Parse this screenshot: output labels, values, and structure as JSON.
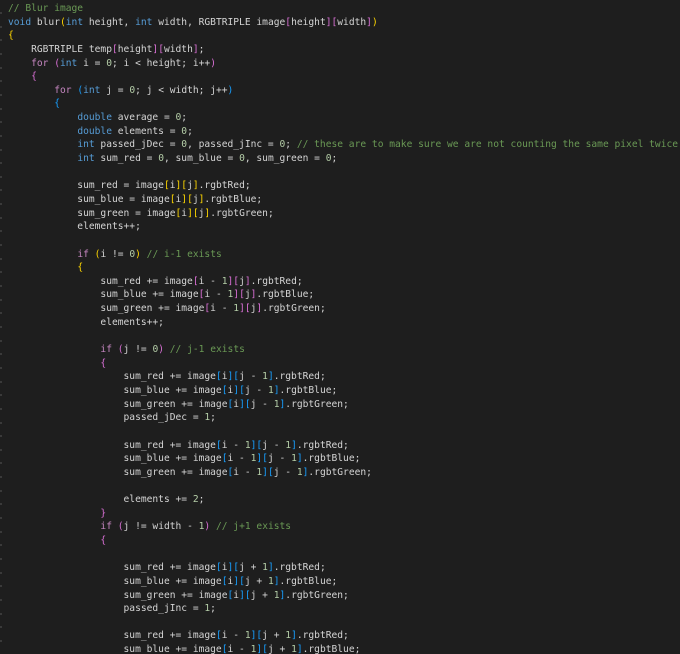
{
  "editor": {
    "colors": {
      "background": "#1e1e1e",
      "text": "#d4d4d4",
      "keyword": "#569cd6",
      "control": "#c586c0",
      "comment": "#6a9955",
      "number": "#b5cea8",
      "bracket_level_1": "#ffd700",
      "bracket_level_2": "#da70d6",
      "bracket_level_3": "#179fff"
    },
    "lines": [
      [
        {
          "t": "// Blur image",
          "c": "cm"
        }
      ],
      [
        {
          "t": "void",
          "c": "kw"
        },
        {
          "t": " blur"
        },
        {
          "t": "(",
          "c": "b1"
        },
        {
          "t": "int",
          "c": "kw"
        },
        {
          "t": " height, "
        },
        {
          "t": "int",
          "c": "kw"
        },
        {
          "t": " width, RGBTRIPLE image"
        },
        {
          "t": "[",
          "c": "b2"
        },
        {
          "t": "height"
        },
        {
          "t": "]",
          "c": "b2"
        },
        {
          "t": "[",
          "c": "b2"
        },
        {
          "t": "width"
        },
        {
          "t": "]",
          "c": "b2"
        },
        {
          "t": ")",
          "c": "b1"
        }
      ],
      [
        {
          "t": "{",
          "c": "b1"
        }
      ],
      [
        {
          "t": "    RGBTRIPLE temp"
        },
        {
          "t": "[",
          "c": "b2"
        },
        {
          "t": "height"
        },
        {
          "t": "]",
          "c": "b2"
        },
        {
          "t": "[",
          "c": "b2"
        },
        {
          "t": "width"
        },
        {
          "t": "]",
          "c": "b2"
        },
        {
          "t": ";"
        }
      ],
      [
        {
          "t": "    "
        },
        {
          "t": "for",
          "c": "ctl"
        },
        {
          "t": " "
        },
        {
          "t": "(",
          "c": "b2"
        },
        {
          "t": "int",
          "c": "kw"
        },
        {
          "t": " i = "
        },
        {
          "t": "0",
          "c": "num"
        },
        {
          "t": "; i < height; i++"
        },
        {
          "t": ")",
          "c": "b2"
        }
      ],
      [
        {
          "t": "    "
        },
        {
          "t": "{",
          "c": "b2"
        }
      ],
      [
        {
          "t": "        "
        },
        {
          "t": "for",
          "c": "ctl"
        },
        {
          "t": " "
        },
        {
          "t": "(",
          "c": "b3"
        },
        {
          "t": "int",
          "c": "kw"
        },
        {
          "t": " j = "
        },
        {
          "t": "0",
          "c": "num"
        },
        {
          "t": "; j < width; j++"
        },
        {
          "t": ")",
          "c": "b3"
        }
      ],
      [
        {
          "t": "        "
        },
        {
          "t": "{",
          "c": "b3"
        }
      ],
      [
        {
          "t": "            "
        },
        {
          "t": "double",
          "c": "kw"
        },
        {
          "t": " average = "
        },
        {
          "t": "0",
          "c": "num"
        },
        {
          "t": ";"
        }
      ],
      [
        {
          "t": "            "
        },
        {
          "t": "double",
          "c": "kw"
        },
        {
          "t": " elements = "
        },
        {
          "t": "0",
          "c": "num"
        },
        {
          "t": ";"
        }
      ],
      [
        {
          "t": "            "
        },
        {
          "t": "int",
          "c": "kw"
        },
        {
          "t": " passed_jDec = "
        },
        {
          "t": "0",
          "c": "num"
        },
        {
          "t": ", passed_jInc = "
        },
        {
          "t": "0",
          "c": "num"
        },
        {
          "t": "; "
        },
        {
          "t": "// these are to make sure we are not counting the same pixel twice",
          "c": "cm"
        }
      ],
      [
        {
          "t": "            "
        },
        {
          "t": "int",
          "c": "kw"
        },
        {
          "t": " sum_red = "
        },
        {
          "t": "0",
          "c": "num"
        },
        {
          "t": ", sum_blue = "
        },
        {
          "t": "0",
          "c": "num"
        },
        {
          "t": ", sum_green = "
        },
        {
          "t": "0",
          "c": "num"
        },
        {
          "t": ";"
        }
      ],
      [],
      [
        {
          "t": "            sum_red = image"
        },
        {
          "t": "[",
          "c": "b1"
        },
        {
          "t": "i"
        },
        {
          "t": "]",
          "c": "b1"
        },
        {
          "t": "[",
          "c": "b1"
        },
        {
          "t": "j"
        },
        {
          "t": "]",
          "c": "b1"
        },
        {
          "t": ".rgbtRed;"
        }
      ],
      [
        {
          "t": "            sum_blue = image"
        },
        {
          "t": "[",
          "c": "b1"
        },
        {
          "t": "i"
        },
        {
          "t": "]",
          "c": "b1"
        },
        {
          "t": "[",
          "c": "b1"
        },
        {
          "t": "j"
        },
        {
          "t": "]",
          "c": "b1"
        },
        {
          "t": ".rgbtBlue;"
        }
      ],
      [
        {
          "t": "            sum_green = image"
        },
        {
          "t": "[",
          "c": "b1"
        },
        {
          "t": "i"
        },
        {
          "t": "]",
          "c": "b1"
        },
        {
          "t": "[",
          "c": "b1"
        },
        {
          "t": "j"
        },
        {
          "t": "]",
          "c": "b1"
        },
        {
          "t": ".rgbtGreen;"
        }
      ],
      [
        {
          "t": "            elements++;"
        }
      ],
      [],
      [
        {
          "t": "            "
        },
        {
          "t": "if",
          "c": "ctl"
        },
        {
          "t": " "
        },
        {
          "t": "(",
          "c": "b1"
        },
        {
          "t": "i != "
        },
        {
          "t": "0",
          "c": "num"
        },
        {
          "t": ")",
          "c": "b1"
        },
        {
          "t": " "
        },
        {
          "t": "// i-1 exists",
          "c": "cm"
        }
      ],
      [
        {
          "t": "            "
        },
        {
          "t": "{",
          "c": "b1"
        }
      ],
      [
        {
          "t": "                sum_red += image"
        },
        {
          "t": "[",
          "c": "b2"
        },
        {
          "t": "i - "
        },
        {
          "t": "1",
          "c": "num"
        },
        {
          "t": "]",
          "c": "b2"
        },
        {
          "t": "[",
          "c": "b2"
        },
        {
          "t": "j"
        },
        {
          "t": "]",
          "c": "b2"
        },
        {
          "t": ".rgbtRed;"
        }
      ],
      [
        {
          "t": "                sum_blue += image"
        },
        {
          "t": "[",
          "c": "b2"
        },
        {
          "t": "i - "
        },
        {
          "t": "1",
          "c": "num"
        },
        {
          "t": "]",
          "c": "b2"
        },
        {
          "t": "[",
          "c": "b2"
        },
        {
          "t": "j"
        },
        {
          "t": "]",
          "c": "b2"
        },
        {
          "t": ".rgbtBlue;"
        }
      ],
      [
        {
          "t": "                sum_green += image"
        },
        {
          "t": "[",
          "c": "b2"
        },
        {
          "t": "i - "
        },
        {
          "t": "1",
          "c": "num"
        },
        {
          "t": "]",
          "c": "b2"
        },
        {
          "t": "[",
          "c": "b2"
        },
        {
          "t": "j"
        },
        {
          "t": "]",
          "c": "b2"
        },
        {
          "t": ".rgbtGreen;"
        }
      ],
      [
        {
          "t": "                elements++;"
        }
      ],
      [],
      [
        {
          "t": "                "
        },
        {
          "t": "if",
          "c": "ctl"
        },
        {
          "t": " "
        },
        {
          "t": "(",
          "c": "b2"
        },
        {
          "t": "j != "
        },
        {
          "t": "0",
          "c": "num"
        },
        {
          "t": ")",
          "c": "b2"
        },
        {
          "t": " "
        },
        {
          "t": "// j-1 exists",
          "c": "cm"
        }
      ],
      [
        {
          "t": "                "
        },
        {
          "t": "{",
          "c": "b2"
        }
      ],
      [
        {
          "t": "                    sum_red += image"
        },
        {
          "t": "[",
          "c": "b3"
        },
        {
          "t": "i"
        },
        {
          "t": "]",
          "c": "b3"
        },
        {
          "t": "[",
          "c": "b3"
        },
        {
          "t": "j - "
        },
        {
          "t": "1",
          "c": "num"
        },
        {
          "t": "]",
          "c": "b3"
        },
        {
          "t": ".rgbtRed;"
        }
      ],
      [
        {
          "t": "                    sum_blue += image"
        },
        {
          "t": "[",
          "c": "b3"
        },
        {
          "t": "i"
        },
        {
          "t": "]",
          "c": "b3"
        },
        {
          "t": "[",
          "c": "b3"
        },
        {
          "t": "j - "
        },
        {
          "t": "1",
          "c": "num"
        },
        {
          "t": "]",
          "c": "b3"
        },
        {
          "t": ".rgbtBlue;"
        }
      ],
      [
        {
          "t": "                    sum_green += image"
        },
        {
          "t": "[",
          "c": "b3"
        },
        {
          "t": "i"
        },
        {
          "t": "]",
          "c": "b3"
        },
        {
          "t": "[",
          "c": "b3"
        },
        {
          "t": "j - "
        },
        {
          "t": "1",
          "c": "num"
        },
        {
          "t": "]",
          "c": "b3"
        },
        {
          "t": ".rgbtGreen;"
        }
      ],
      [
        {
          "t": "                    passed_jDec = "
        },
        {
          "t": "1",
          "c": "num"
        },
        {
          "t": ";"
        }
      ],
      [],
      [
        {
          "t": "                    sum_red += image"
        },
        {
          "t": "[",
          "c": "b3"
        },
        {
          "t": "i - "
        },
        {
          "t": "1",
          "c": "num"
        },
        {
          "t": "]",
          "c": "b3"
        },
        {
          "t": "[",
          "c": "b3"
        },
        {
          "t": "j - "
        },
        {
          "t": "1",
          "c": "num"
        },
        {
          "t": "]",
          "c": "b3"
        },
        {
          "t": ".rgbtRed;"
        }
      ],
      [
        {
          "t": "                    sum_blue += image"
        },
        {
          "t": "[",
          "c": "b3"
        },
        {
          "t": "i - "
        },
        {
          "t": "1",
          "c": "num"
        },
        {
          "t": "]",
          "c": "b3"
        },
        {
          "t": "[",
          "c": "b3"
        },
        {
          "t": "j - "
        },
        {
          "t": "1",
          "c": "num"
        },
        {
          "t": "]",
          "c": "b3"
        },
        {
          "t": ".rgbtBlue;"
        }
      ],
      [
        {
          "t": "                    sum_green += image"
        },
        {
          "t": "[",
          "c": "b3"
        },
        {
          "t": "i - "
        },
        {
          "t": "1",
          "c": "num"
        },
        {
          "t": "]",
          "c": "b3"
        },
        {
          "t": "[",
          "c": "b3"
        },
        {
          "t": "j - "
        },
        {
          "t": "1",
          "c": "num"
        },
        {
          "t": "]",
          "c": "b3"
        },
        {
          "t": ".rgbtGreen;"
        }
      ],
      [],
      [
        {
          "t": "                    elements += "
        },
        {
          "t": "2",
          "c": "num"
        },
        {
          "t": ";"
        }
      ],
      [
        {
          "t": "                "
        },
        {
          "t": "}",
          "c": "b2"
        }
      ],
      [
        {
          "t": "                "
        },
        {
          "t": "if",
          "c": "ctl"
        },
        {
          "t": " "
        },
        {
          "t": "(",
          "c": "b2"
        },
        {
          "t": "j != width - "
        },
        {
          "t": "1",
          "c": "num"
        },
        {
          "t": ")",
          "c": "b2"
        },
        {
          "t": " "
        },
        {
          "t": "// j+1 exists",
          "c": "cm"
        }
      ],
      [
        {
          "t": "                "
        },
        {
          "t": "{",
          "c": "b2"
        }
      ],
      [],
      [
        {
          "t": "                    sum_red += image"
        },
        {
          "t": "[",
          "c": "b3"
        },
        {
          "t": "i"
        },
        {
          "t": "]",
          "c": "b3"
        },
        {
          "t": "[",
          "c": "b3"
        },
        {
          "t": "j + "
        },
        {
          "t": "1",
          "c": "num"
        },
        {
          "t": "]",
          "c": "b3"
        },
        {
          "t": ".rgbtRed;"
        }
      ],
      [
        {
          "t": "                    sum_blue += image"
        },
        {
          "t": "[",
          "c": "b3"
        },
        {
          "t": "i"
        },
        {
          "t": "]",
          "c": "b3"
        },
        {
          "t": "[",
          "c": "b3"
        },
        {
          "t": "j + "
        },
        {
          "t": "1",
          "c": "num"
        },
        {
          "t": "]",
          "c": "b3"
        },
        {
          "t": ".rgbtBlue;"
        }
      ],
      [
        {
          "t": "                    sum_green += image"
        },
        {
          "t": "[",
          "c": "b3"
        },
        {
          "t": "i"
        },
        {
          "t": "]",
          "c": "b3"
        },
        {
          "t": "[",
          "c": "b3"
        },
        {
          "t": "j + "
        },
        {
          "t": "1",
          "c": "num"
        },
        {
          "t": "]",
          "c": "b3"
        },
        {
          "t": ".rgbtGreen;"
        }
      ],
      [
        {
          "t": "                    passed_jInc = "
        },
        {
          "t": "1",
          "c": "num"
        },
        {
          "t": ";"
        }
      ],
      [],
      [
        {
          "t": "                    sum_red += image"
        },
        {
          "t": "[",
          "c": "b3"
        },
        {
          "t": "i - "
        },
        {
          "t": "1",
          "c": "num"
        },
        {
          "t": "]",
          "c": "b3"
        },
        {
          "t": "[",
          "c": "b3"
        },
        {
          "t": "j + "
        },
        {
          "t": "1",
          "c": "num"
        },
        {
          "t": "]",
          "c": "b3"
        },
        {
          "t": ".rgbtRed;"
        }
      ],
      [
        {
          "t": "                    sum_blue += image"
        },
        {
          "t": "[",
          "c": "b3"
        },
        {
          "t": "i - "
        },
        {
          "t": "1",
          "c": "num"
        },
        {
          "t": "]",
          "c": "b3"
        },
        {
          "t": "[",
          "c": "b3"
        },
        {
          "t": "j + "
        },
        {
          "t": "1",
          "c": "num"
        },
        {
          "t": "]",
          "c": "b3"
        },
        {
          "t": ".rgbtBlue;"
        }
      ]
    ]
  }
}
